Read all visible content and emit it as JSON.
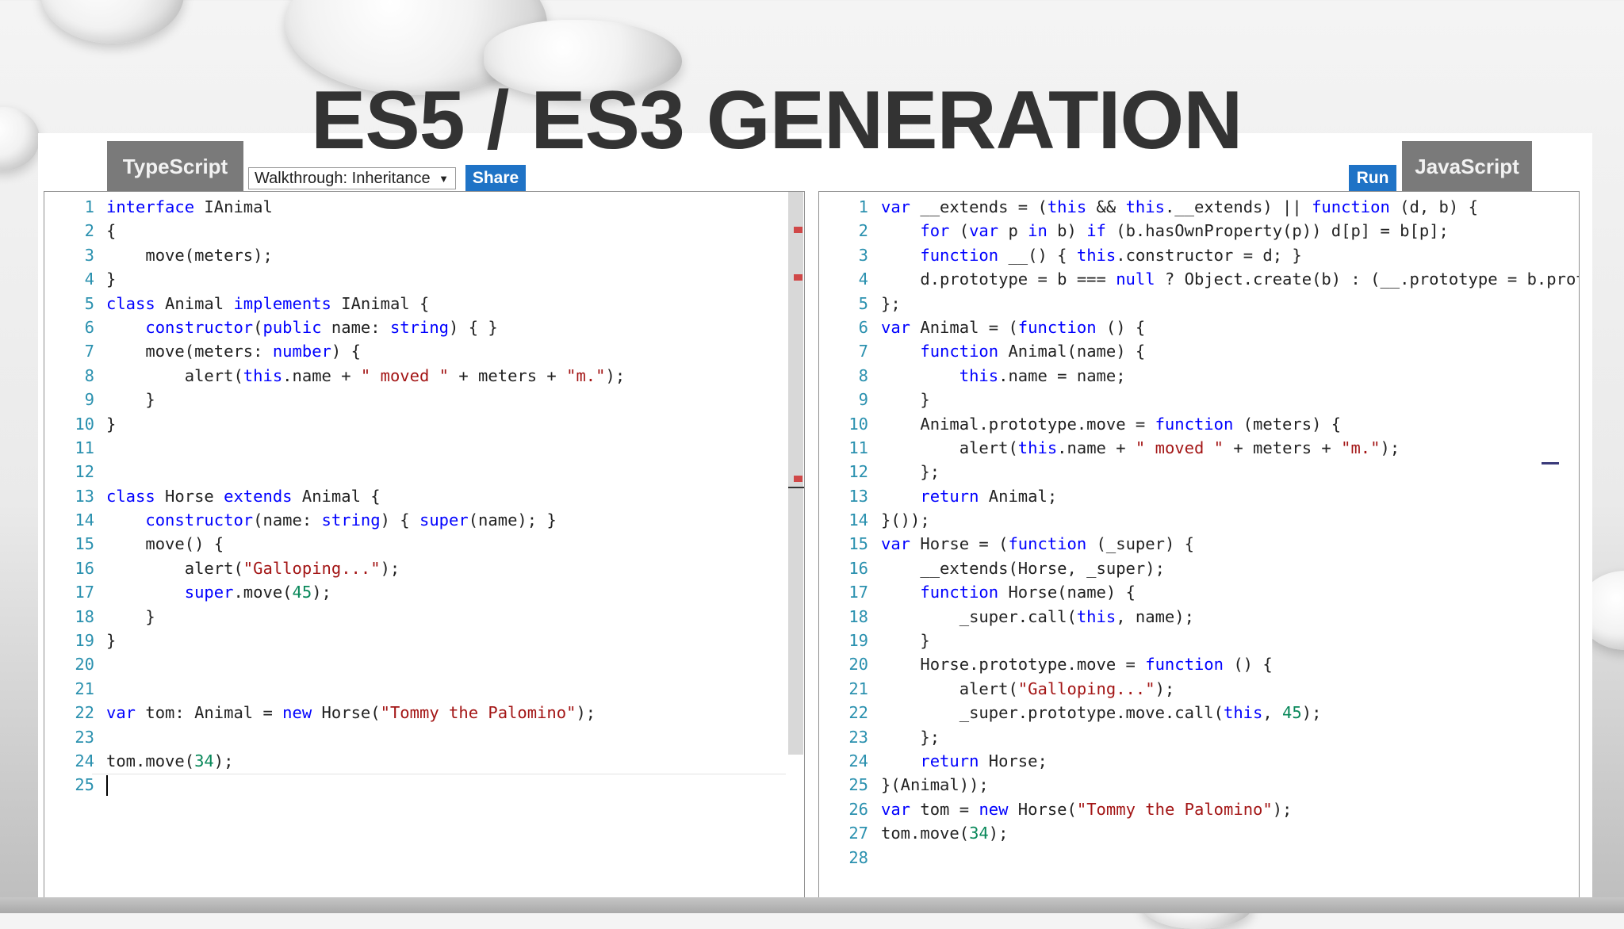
{
  "slide": {
    "title": "ES5 / ES3 GENERATION"
  },
  "playground": {
    "ts_tab": "TypeScript",
    "js_tab": "JavaScript",
    "walkthrough": {
      "selected": "Walkthrough: Inheritance",
      "arrow": "▼"
    },
    "share_label": "Share",
    "run_label": "Run"
  },
  "typescript_editor": {
    "lines": [
      {
        "n": "1",
        "tokens": [
          {
            "t": "kw",
            "v": "interface"
          },
          {
            "t": "",
            "v": " IAnimal"
          }
        ]
      },
      {
        "n": "2",
        "tokens": [
          {
            "t": "",
            "v": "{"
          }
        ]
      },
      {
        "n": "3",
        "tokens": [
          {
            "t": "",
            "v": "    move(meters);"
          }
        ]
      },
      {
        "n": "4",
        "tokens": [
          {
            "t": "",
            "v": "}"
          }
        ]
      },
      {
        "n": "5",
        "tokens": [
          {
            "t": "kw",
            "v": "class"
          },
          {
            "t": "",
            "v": " Animal "
          },
          {
            "t": "kw",
            "v": "implements"
          },
          {
            "t": "",
            "v": " IAnimal {"
          }
        ]
      },
      {
        "n": "6",
        "tokens": [
          {
            "t": "",
            "v": "    "
          },
          {
            "t": "kw",
            "v": "constructor"
          },
          {
            "t": "",
            "v": "("
          },
          {
            "t": "kw",
            "v": "public"
          },
          {
            "t": "",
            "v": " name: "
          },
          {
            "t": "kw",
            "v": "string"
          },
          {
            "t": "",
            "v": ") { }"
          }
        ]
      },
      {
        "n": "7",
        "tokens": [
          {
            "t": "",
            "v": "    move(meters: "
          },
          {
            "t": "kw",
            "v": "number"
          },
          {
            "t": "",
            "v": ") {"
          }
        ]
      },
      {
        "n": "8",
        "tokens": [
          {
            "t": "",
            "v": "        alert("
          },
          {
            "t": "kw",
            "v": "this"
          },
          {
            "t": "",
            "v": ".name + "
          },
          {
            "t": "str",
            "v": "\" moved \""
          },
          {
            "t": "",
            "v": " + meters + "
          },
          {
            "t": "str",
            "v": "\"m.\""
          },
          {
            "t": "",
            "v": ");"
          }
        ]
      },
      {
        "n": "9",
        "tokens": [
          {
            "t": "",
            "v": "    }"
          }
        ]
      },
      {
        "n": "10",
        "tokens": [
          {
            "t": "",
            "v": "}"
          }
        ]
      },
      {
        "n": "11",
        "tokens": []
      },
      {
        "n": "12",
        "tokens": []
      },
      {
        "n": "13",
        "tokens": [
          {
            "t": "kw",
            "v": "class"
          },
          {
            "t": "",
            "v": " Horse "
          },
          {
            "t": "kw",
            "v": "extends"
          },
          {
            "t": "",
            "v": " Animal {"
          }
        ]
      },
      {
        "n": "14",
        "tokens": [
          {
            "t": "",
            "v": "    "
          },
          {
            "t": "kw",
            "v": "constructor"
          },
          {
            "t": "",
            "v": "(name: "
          },
          {
            "t": "kw",
            "v": "string"
          },
          {
            "t": "",
            "v": ") { "
          },
          {
            "t": "kw",
            "v": "super"
          },
          {
            "t": "",
            "v": "(name); }"
          }
        ]
      },
      {
        "n": "15",
        "tokens": [
          {
            "t": "",
            "v": "    move() {"
          }
        ]
      },
      {
        "n": "16",
        "tokens": [
          {
            "t": "",
            "v": "        alert("
          },
          {
            "t": "str",
            "v": "\"Galloping...\""
          },
          {
            "t": "",
            "v": ");"
          }
        ]
      },
      {
        "n": "17",
        "tokens": [
          {
            "t": "",
            "v": "        "
          },
          {
            "t": "kw",
            "v": "super"
          },
          {
            "t": "",
            "v": ".move("
          },
          {
            "t": "num",
            "v": "45"
          },
          {
            "t": "",
            "v": ");"
          }
        ]
      },
      {
        "n": "18",
        "tokens": [
          {
            "t": "",
            "v": "    }"
          }
        ]
      },
      {
        "n": "19",
        "tokens": [
          {
            "t": "",
            "v": "}"
          }
        ]
      },
      {
        "n": "20",
        "tokens": []
      },
      {
        "n": "21",
        "tokens": []
      },
      {
        "n": "22",
        "tokens": [
          {
            "t": "kw",
            "v": "var"
          },
          {
            "t": "",
            "v": " tom: Animal = "
          },
          {
            "t": "kw",
            "v": "new"
          },
          {
            "t": "",
            "v": " Horse("
          },
          {
            "t": "str",
            "v": "\"Tommy the Palomino\""
          },
          {
            "t": "",
            "v": ");"
          }
        ]
      },
      {
        "n": "23",
        "tokens": []
      },
      {
        "n": "24",
        "tokens": [
          {
            "t": "",
            "v": "tom.move("
          },
          {
            "t": "num",
            "v": "34"
          },
          {
            "t": "",
            "v": ");"
          }
        ]
      },
      {
        "n": "25",
        "tokens": [],
        "cursor": true
      }
    ]
  },
  "javascript_editor": {
    "lines": [
      {
        "n": "1",
        "tokens": [
          {
            "t": "kw",
            "v": "var"
          },
          {
            "t": "",
            "v": " __extends = ("
          },
          {
            "t": "kw",
            "v": "this"
          },
          {
            "t": "",
            "v": " && "
          },
          {
            "t": "kw",
            "v": "this"
          },
          {
            "t": "",
            "v": ".__extends) || "
          },
          {
            "t": "kw",
            "v": "function"
          },
          {
            "t": "",
            "v": " (d, b) {"
          }
        ]
      },
      {
        "n": "2",
        "tokens": [
          {
            "t": "",
            "v": "    "
          },
          {
            "t": "kw",
            "v": "for"
          },
          {
            "t": "",
            "v": " ("
          },
          {
            "t": "kw",
            "v": "var"
          },
          {
            "t": "",
            "v": " p "
          },
          {
            "t": "kw",
            "v": "in"
          },
          {
            "t": "",
            "v": " b) "
          },
          {
            "t": "kw",
            "v": "if"
          },
          {
            "t": "",
            "v": " (b.hasOwnProperty(p)) d[p] = b[p];"
          }
        ]
      },
      {
        "n": "3",
        "tokens": [
          {
            "t": "",
            "v": "    "
          },
          {
            "t": "kw",
            "v": "function"
          },
          {
            "t": "",
            "v": " __() { "
          },
          {
            "t": "kw",
            "v": "this"
          },
          {
            "t": "",
            "v": ".constructor = d; }"
          }
        ]
      },
      {
        "n": "4",
        "tokens": [
          {
            "t": "",
            "v": "    d.prototype = b === "
          },
          {
            "t": "kw",
            "v": "null"
          },
          {
            "t": "",
            "v": " ? Object.create(b) : (__.prototype = b.prot"
          }
        ]
      },
      {
        "n": "5",
        "tokens": [
          {
            "t": "",
            "v": "};"
          }
        ]
      },
      {
        "n": "6",
        "tokens": [
          {
            "t": "kw",
            "v": "var"
          },
          {
            "t": "",
            "v": " Animal = ("
          },
          {
            "t": "kw",
            "v": "function"
          },
          {
            "t": "",
            "v": " () {"
          }
        ]
      },
      {
        "n": "7",
        "tokens": [
          {
            "t": "",
            "v": "    "
          },
          {
            "t": "kw",
            "v": "function"
          },
          {
            "t": "",
            "v": " Animal(name) {"
          }
        ]
      },
      {
        "n": "8",
        "tokens": [
          {
            "t": "",
            "v": "        "
          },
          {
            "t": "kw",
            "v": "this"
          },
          {
            "t": "",
            "v": ".name = name;"
          }
        ]
      },
      {
        "n": "9",
        "tokens": [
          {
            "t": "",
            "v": "    }"
          }
        ]
      },
      {
        "n": "10",
        "tokens": [
          {
            "t": "",
            "v": "    Animal.prototype.move = "
          },
          {
            "t": "kw",
            "v": "function"
          },
          {
            "t": "",
            "v": " (meters) {"
          }
        ]
      },
      {
        "n": "11",
        "tokens": [
          {
            "t": "",
            "v": "        alert("
          },
          {
            "t": "kw",
            "v": "this"
          },
          {
            "t": "",
            "v": ".name + "
          },
          {
            "t": "str",
            "v": "\" moved \""
          },
          {
            "t": "",
            "v": " + meters + "
          },
          {
            "t": "str",
            "v": "\"m.\""
          },
          {
            "t": "",
            "v": ");"
          }
        ]
      },
      {
        "n": "12",
        "tokens": [
          {
            "t": "",
            "v": "    };"
          }
        ]
      },
      {
        "n": "13",
        "tokens": [
          {
            "t": "",
            "v": "    "
          },
          {
            "t": "kw",
            "v": "return"
          },
          {
            "t": "",
            "v": " Animal;"
          }
        ]
      },
      {
        "n": "14",
        "tokens": [
          {
            "t": "",
            "v": "}());"
          }
        ]
      },
      {
        "n": "15",
        "tokens": [
          {
            "t": "kw",
            "v": "var"
          },
          {
            "t": "",
            "v": " Horse = ("
          },
          {
            "t": "kw",
            "v": "function"
          },
          {
            "t": "",
            "v": " (_super) {"
          }
        ]
      },
      {
        "n": "16",
        "tokens": [
          {
            "t": "",
            "v": "    __extends(Horse, _super);"
          }
        ]
      },
      {
        "n": "17",
        "tokens": [
          {
            "t": "",
            "v": "    "
          },
          {
            "t": "kw",
            "v": "function"
          },
          {
            "t": "",
            "v": " Horse(name) {"
          }
        ]
      },
      {
        "n": "18",
        "tokens": [
          {
            "t": "",
            "v": "        _super.call("
          },
          {
            "t": "kw",
            "v": "this"
          },
          {
            "t": "",
            "v": ", name);"
          }
        ]
      },
      {
        "n": "19",
        "tokens": [
          {
            "t": "",
            "v": "    }"
          }
        ]
      },
      {
        "n": "20",
        "tokens": [
          {
            "t": "",
            "v": "    Horse.prototype.move = "
          },
          {
            "t": "kw",
            "v": "function"
          },
          {
            "t": "",
            "v": " () {"
          }
        ]
      },
      {
        "n": "21",
        "tokens": [
          {
            "t": "",
            "v": "        alert("
          },
          {
            "t": "str",
            "v": "\"Galloping...\""
          },
          {
            "t": "",
            "v": ");"
          }
        ]
      },
      {
        "n": "22",
        "tokens": [
          {
            "t": "",
            "v": "        _super.prototype.move.call("
          },
          {
            "t": "kw",
            "v": "this"
          },
          {
            "t": "",
            "v": ", "
          },
          {
            "t": "num",
            "v": "45"
          },
          {
            "t": "",
            "v": ");"
          }
        ]
      },
      {
        "n": "23",
        "tokens": [
          {
            "t": "",
            "v": "    };"
          }
        ]
      },
      {
        "n": "24",
        "tokens": [
          {
            "t": "",
            "v": "    "
          },
          {
            "t": "kw",
            "v": "return"
          },
          {
            "t": "",
            "v": " Horse;"
          }
        ]
      },
      {
        "n": "25",
        "tokens": [
          {
            "t": "",
            "v": "}(Animal));"
          }
        ]
      },
      {
        "n": "26",
        "tokens": [
          {
            "t": "kw",
            "v": "var"
          },
          {
            "t": "",
            "v": " tom = "
          },
          {
            "t": "kw",
            "v": "new"
          },
          {
            "t": "",
            "v": " Horse("
          },
          {
            "t": "str",
            "v": "\"Tommy the Palomino\""
          },
          {
            "t": "",
            "v": ");"
          }
        ]
      },
      {
        "n": "27",
        "tokens": [
          {
            "t": "",
            "v": "tom.move("
          },
          {
            "t": "num",
            "v": "34"
          },
          {
            "t": "",
            "v": ");"
          }
        ]
      },
      {
        "n": "28",
        "tokens": []
      }
    ]
  },
  "colors": {
    "keyword": "#0000ff",
    "string": "#a31515",
    "number": "#09885a",
    "line_number": "#2b91af",
    "tab": "#7a7a7a",
    "button": "#1f73c6",
    "error_marker": "#d04848"
  }
}
